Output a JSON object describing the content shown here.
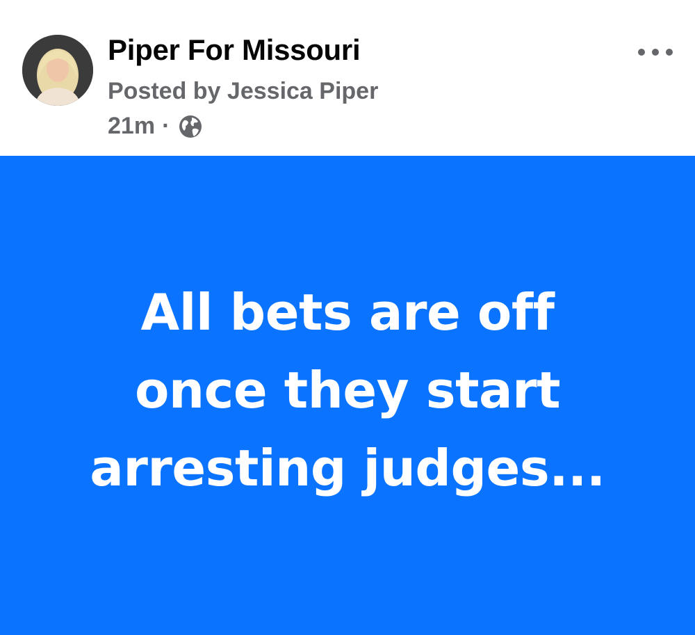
{
  "post": {
    "page_name": "Piper For Missouri",
    "posted_by": "Posted by Jessica Piper",
    "timestamp": "21m",
    "separator": "·",
    "audience_icon": "globe-icon",
    "more_icon": "more-options-icon",
    "avatar_icon": "profile-avatar",
    "background_color": "#0a73ff",
    "text_lines": [
      "All bets are off",
      "once they start",
      "arresting judges..."
    ]
  }
}
